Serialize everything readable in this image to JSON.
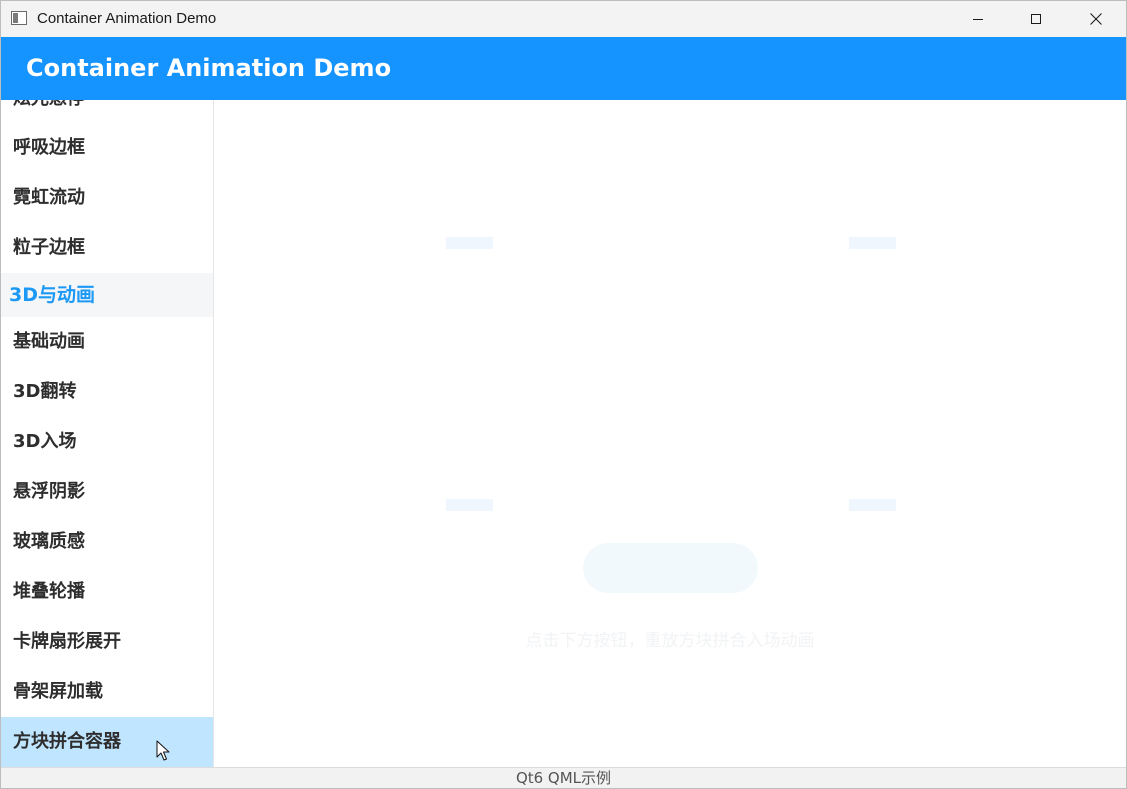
{
  "window": {
    "title": "Container Animation Demo"
  },
  "header": {
    "title": "Container Animation Demo",
    "color": "#1593ff"
  },
  "sidebar": {
    "items": [
      {
        "label": "炫光悬停"
      },
      {
        "label": "呼吸边框"
      },
      {
        "label": "霓虹流动"
      },
      {
        "label": "粒子边框"
      },
      {
        "label": "3D与动画",
        "type": "group"
      },
      {
        "label": "基础动画"
      },
      {
        "label": "3D翻转"
      },
      {
        "label": "3D入场"
      },
      {
        "label": "悬浮阴影"
      },
      {
        "label": "玻璃质感"
      },
      {
        "label": "堆叠轮播"
      },
      {
        "label": "卡牌扇形展开"
      },
      {
        "label": "骨架屏加载"
      },
      {
        "label": "方块拼合容器",
        "selected": true
      }
    ],
    "group_color": "#1c98f5",
    "selected_color": "#c0e5fe"
  },
  "content": {
    "hint": "点击下方按钮，重放方块拼合入场动画"
  },
  "footer": {
    "text": "Qt6 QML示例"
  }
}
